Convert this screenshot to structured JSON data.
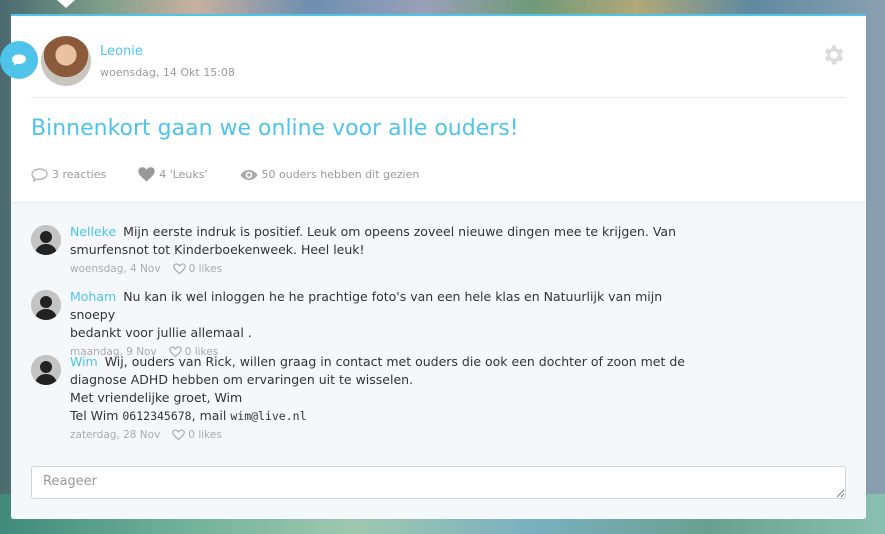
{
  "post": {
    "author": "Leonie",
    "date": "woensdag, 14 Okt 15:08",
    "title": "Binnenkort gaan we online voor alle ouders!",
    "stats": {
      "reactions": "3 reacties",
      "likes": "4 'Leuks'",
      "views": "50 ouders hebben dit gezien"
    }
  },
  "comments": [
    {
      "name": "Nelleke",
      "lines": [
        "Mijn eerste indruk is positief. Leuk om opeens zoveel nieuwe dingen mee te krijgen. Van",
        "smurfensnot tot Kinderboekenweek. Heel leuk!"
      ],
      "date": "woensdag, 4 Nov",
      "likes": "0 likes"
    },
    {
      "name": "Moham",
      "lines": [
        "Nu kan ik wel inloggen he he prachtige foto's van een hele klas en Natuurlijk van mijn snoepy",
        "bedankt voor jullie allemaal ."
      ],
      "date": "maandag, 9 Nov",
      "likes": "0 likes"
    },
    {
      "name": "Wim",
      "line1_pre": "Wij, ouders van ",
      "line1_name": "Rick",
      "line1_post": ", willen graag in contact met ouders die ook een dochter of zoon met de",
      "line2": "diagnose ADHD hebben om ervaringen uit te wisselen.",
      "line3": "Met vriendelijke groet, Wim",
      "tel_label": "Tel Wim",
      "tel_number": "0612345678",
      "mail_label": ", mail",
      "mail_address": "wim@live.nl",
      "date": "zaterdag, 28 Nov",
      "likes": "0 likes"
    }
  ],
  "reply": {
    "placeholder": "Reageer"
  },
  "colors": {
    "accent": "#4fc3e8"
  }
}
